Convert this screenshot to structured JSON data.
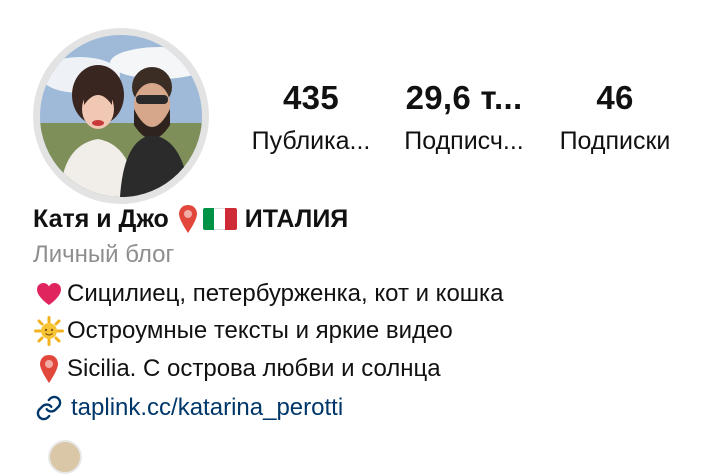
{
  "profile": {
    "avatar_alt": "Profile photo of a couple",
    "stats": [
      {
        "count": "435",
        "label": "Публика..."
      },
      {
        "count": "29,6 т...",
        "label": "Подписч..."
      },
      {
        "count": "46",
        "label": "Подписки"
      }
    ],
    "name": "Катя и Джо",
    "name_suffix": "ИТАЛИЯ",
    "category": "Личный блог",
    "bio": [
      {
        "icon": "heart-icon",
        "text": "Сицилиец, петербурженка, кот и кошка"
      },
      {
        "icon": "sun-icon",
        "text": "Остроумные тексты и яркие видео"
      },
      {
        "icon": "pin-icon",
        "text": "Sicilia. С острова любви и солнца"
      }
    ],
    "link": {
      "icon": "link-icon",
      "text": "taplink.cc/katarina_perotti"
    }
  },
  "colors": {
    "text": "#111111",
    "muted": "#8e8e8e",
    "link": "#00376b",
    "heart": "#e0245e",
    "pin": "#e2473b",
    "flag_green": "#009246",
    "flag_white": "#ffffff",
    "flag_red": "#ce2b37"
  }
}
